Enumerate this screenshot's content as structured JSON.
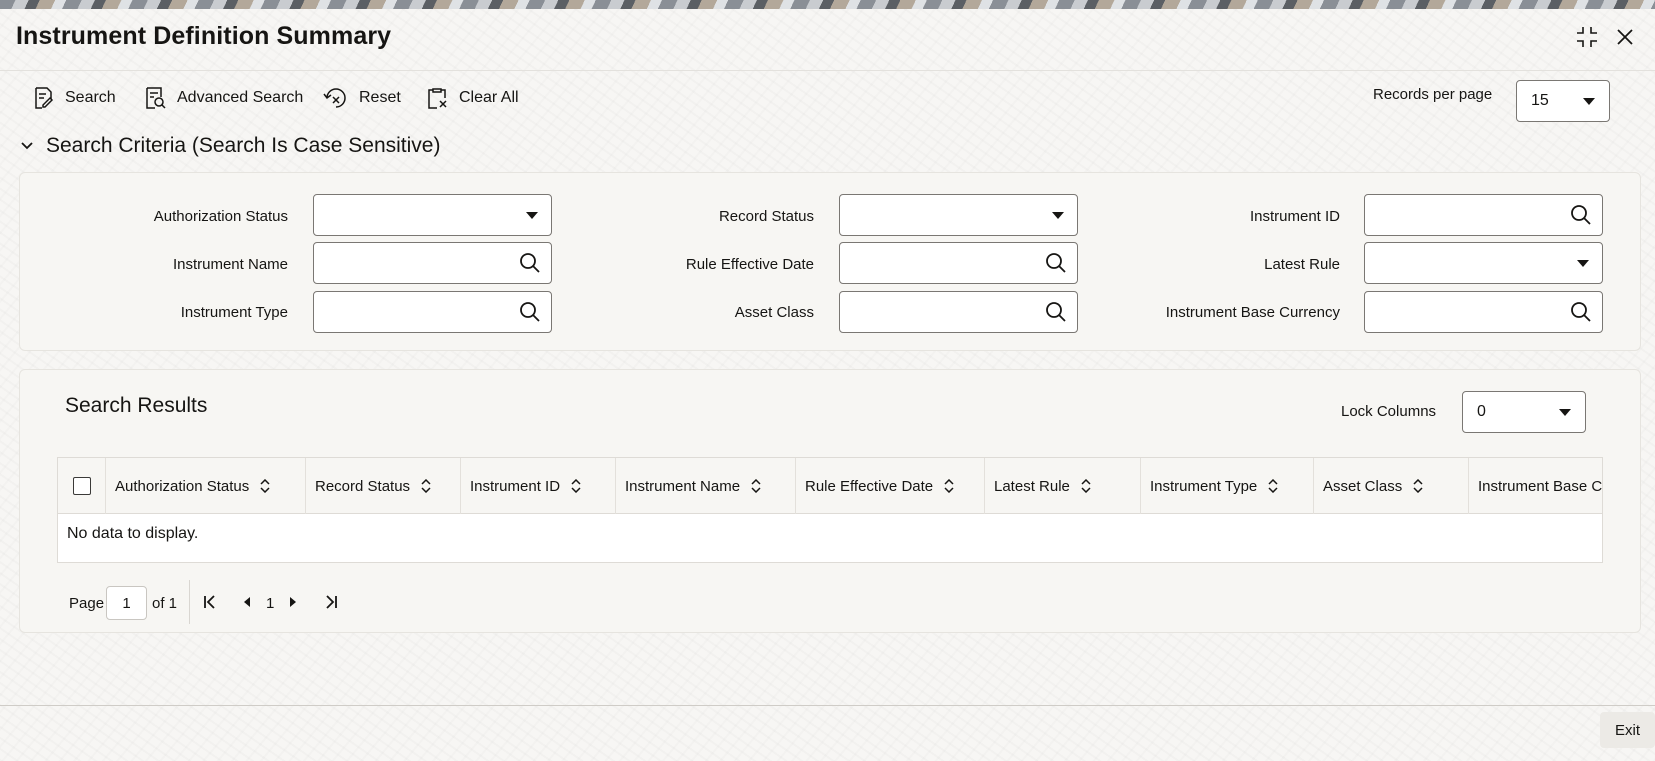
{
  "window": {
    "title": "Instrument Definition Summary"
  },
  "toolbar": {
    "search_label": "Search",
    "advanced_search_label": "Advanced Search",
    "reset_label": "Reset",
    "clear_all_label": "Clear All",
    "records_per_page_label": "Records per page",
    "records_per_page_value": "15"
  },
  "criteria": {
    "heading": "Search Criteria (Search Is Case Sensitive)",
    "fields": {
      "authorization_status": "Authorization Status",
      "record_status": "Record Status",
      "instrument_id": "Instrument ID",
      "instrument_name": "Instrument Name",
      "rule_effective_date": "Rule Effective Date",
      "latest_rule": "Latest Rule",
      "instrument_type": "Instrument Type",
      "asset_class": "Asset Class",
      "instrument_base_currency": "Instrument Base Currency"
    }
  },
  "results": {
    "title": "Search Results",
    "lock_columns_label": "Lock Columns",
    "lock_columns_value": "0",
    "columns": [
      "Authorization Status",
      "Record Status",
      "Instrument ID",
      "Instrument Name",
      "Rule Effective Date",
      "Latest Rule",
      "Instrument Type",
      "Asset Class",
      "Instrument Base C"
    ],
    "empty_message": "No data to display."
  },
  "pagination": {
    "page_label": "Page",
    "page_value": "1",
    "of_label": "of 1",
    "current_page": "1"
  },
  "footer": {
    "exit_label": "Exit"
  },
  "icons": {
    "maximize": "collapse-arrows-icon",
    "close": "close-icon",
    "lookup": "search-icon",
    "sort": "sort-icon"
  }
}
